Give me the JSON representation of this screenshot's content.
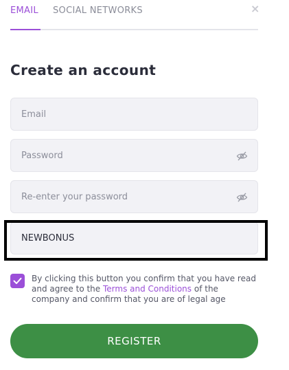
{
  "tabs": {
    "email": "EMAIL",
    "social": "SOCIAL NETWORKS"
  },
  "close_icon": "×",
  "form": {
    "title": "Create an account",
    "email": {
      "placeholder": "Email",
      "value": ""
    },
    "password": {
      "placeholder": "Password",
      "value": ""
    },
    "repassword": {
      "placeholder": "Re-enter your password",
      "value": ""
    },
    "promo": {
      "placeholder": "",
      "value": "NEWBONUS"
    },
    "consent": {
      "checked": true,
      "text_before": "By clicking this button you confirm that you have read and agree to the ",
      "link": "Terms and Conditions",
      "text_after": " of the company and confirm that you are of legal age"
    },
    "register_label": "REGISTER"
  },
  "colors": {
    "accent": "#9b4fd8",
    "button": "#3d8f45",
    "field_bg": "#f2f2f6",
    "highlight": "#000000"
  }
}
